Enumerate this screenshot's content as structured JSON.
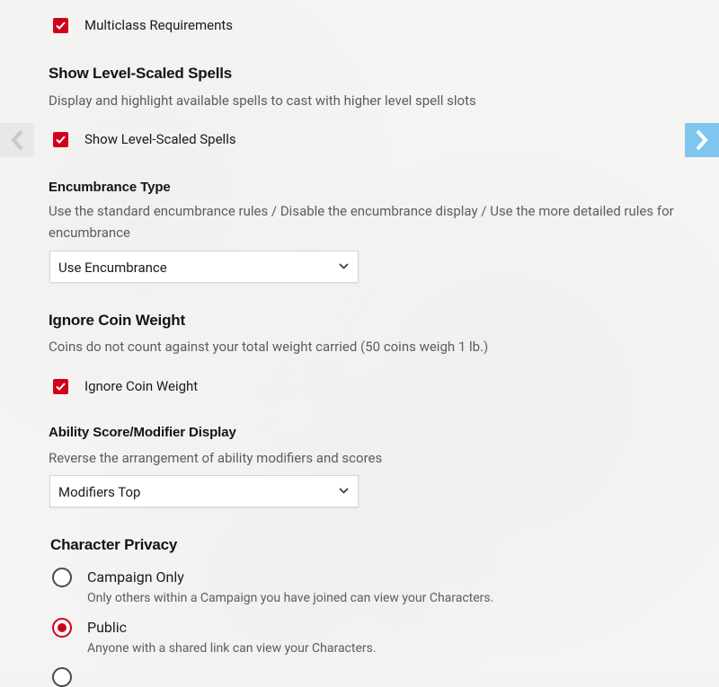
{
  "multiclass": {
    "label": "Multiclass Requirements",
    "checked": true
  },
  "level_scaled": {
    "title": "Show Level-Scaled Spells",
    "description": "Display and highlight available spells to cast with higher level spell slots",
    "checkbox_label": "Show Level-Scaled Spells",
    "checked": true
  },
  "encumbrance": {
    "title": "Encumbrance Type",
    "description": "Use the standard encumbrance rules / Disable the encumbrance display / Use the more detailed rules for encumbrance",
    "selected": "Use Encumbrance"
  },
  "coin_weight": {
    "title": "Ignore Coin Weight",
    "description": "Coins do not count against your total weight carried (50 coins weigh 1 lb.)",
    "checkbox_label": "Ignore Coin Weight",
    "checked": true
  },
  "ability_display": {
    "title": "Ability Score/Modifier Display",
    "description": "Reverse the arrangement of ability modifiers and scores",
    "selected": "Modifiers Top"
  },
  "privacy": {
    "title": "Character Privacy",
    "options": [
      {
        "label": "Campaign Only",
        "description": "Only others within a Campaign you have joined can view your Characters.",
        "selected": false
      },
      {
        "label": "Public",
        "description": "Anyone with a shared link can view your Characters.",
        "selected": true
      }
    ]
  },
  "colors": {
    "accent_red": "#d0021b",
    "nav_right_blue": "#7fc6ef",
    "nav_left_gray": "#e9e8e6"
  },
  "icons": {
    "nav_left": "chevron-left-icon",
    "nav_right": "chevron-right-icon",
    "checkmark": "checkmark-icon",
    "dropdown": "chevron-down-icon"
  }
}
